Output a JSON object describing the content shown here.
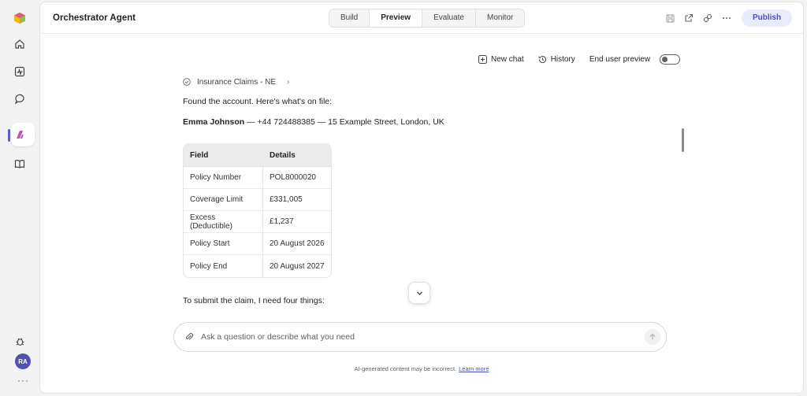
{
  "rail": {
    "items": [
      {
        "icon": "logo-cube-icon"
      },
      {
        "icon": "home-icon"
      },
      {
        "icon": "activity-icon"
      },
      {
        "icon": "chat-icon"
      },
      {
        "icon": "agent-icon",
        "active": true
      },
      {
        "icon": "library-icon"
      }
    ],
    "bottom_icon": "bug-icon",
    "avatar_initials": "RA",
    "more": "···"
  },
  "header": {
    "title": "Orchestrator Agent",
    "tabs": [
      {
        "label": "Build"
      },
      {
        "label": "Preview",
        "active": true
      },
      {
        "label": "Evaluate"
      },
      {
        "label": "Monitor"
      }
    ],
    "icons": [
      "save-icon",
      "share-icon",
      "copilot-icon",
      "more-icon"
    ],
    "publish_label": "Publish"
  },
  "chat_toolbar": {
    "new_chat": "New chat",
    "history": "History",
    "end_user_preview": "End user preview",
    "toggle_on": false
  },
  "conversation": {
    "tool_label": "Insurance Claims - NE",
    "found_text": "Found the account. Here's what's on file:",
    "customer_name": "Emma Johnson",
    "customer_details": " — +44 724488385 — 15 Example Street, London, UK",
    "table": {
      "headers": [
        "Field",
        "Details"
      ],
      "rows": [
        [
          "Policy Number",
          "POL8000020"
        ],
        [
          "Coverage Limit",
          "£331,005"
        ],
        [
          "Excess (Deductible)",
          "£1,237"
        ],
        [
          "Policy Start",
          "20 August 2026"
        ],
        [
          "Policy End",
          "20 August 2027"
        ]
      ]
    },
    "followup": "To submit the claim, I need four things:"
  },
  "composer": {
    "placeholder": "Ask a question or describe what you need"
  },
  "footer": {
    "disclaimer": "AI-generated content may be incorrect.",
    "learn_more": "Learn more"
  },
  "colors": {
    "accent": "#4f52b2",
    "publish_bg": "#e8ebfa"
  }
}
